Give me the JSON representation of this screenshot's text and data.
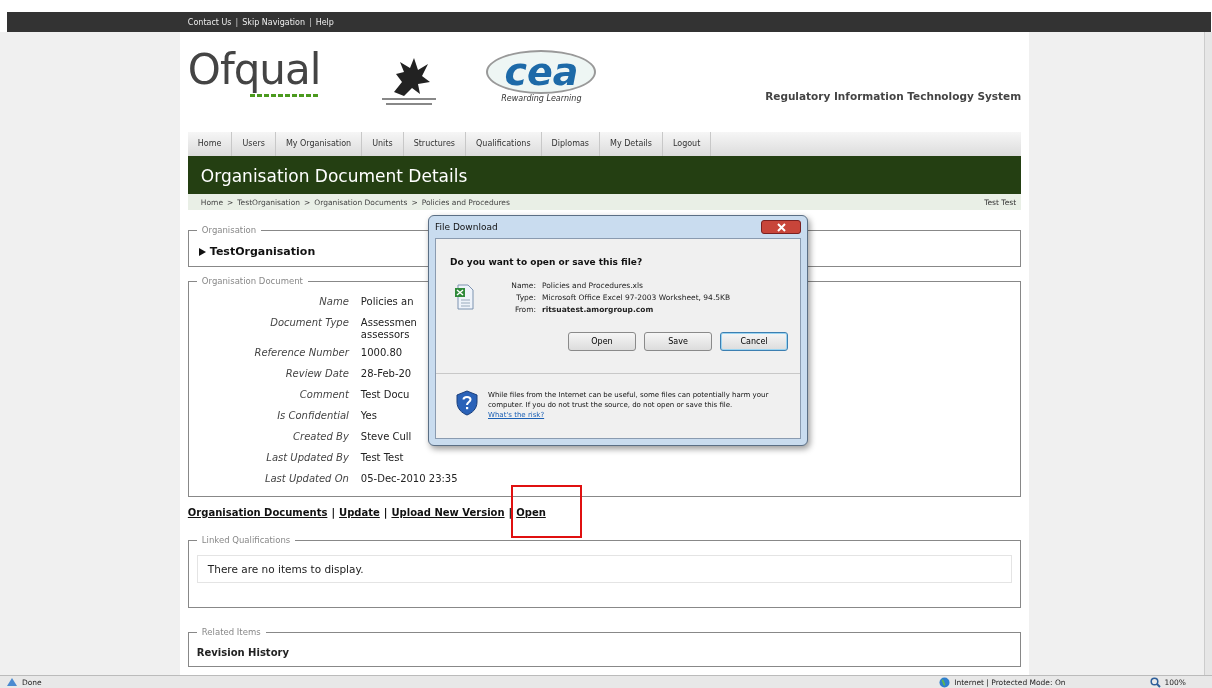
{
  "top_links": [
    "Contact Us",
    "Skip Navigation",
    "Help"
  ],
  "top_links_separator": "|",
  "header": {
    "logo": "Ofqual",
    "partner_logo": "cea",
    "partner_tagline": "Rewarding Learning",
    "system_name": "Regulatory Information Technology System"
  },
  "nav": [
    {
      "label": "Home"
    },
    {
      "label": "Users"
    },
    {
      "label": "My Organisation"
    },
    {
      "label": "Units"
    },
    {
      "label": "Structures"
    },
    {
      "label": "Qualifications"
    },
    {
      "label": "Diplomas"
    },
    {
      "label": "My Details"
    },
    {
      "label": "Logout"
    }
  ],
  "page_title": "Organisation Document Details",
  "breadcrumb": [
    "Home",
    "TestOrganisation",
    "Organisation Documents",
    "Policies and Procedures"
  ],
  "breadcrumb_separator": ">",
  "user": "Test Test",
  "organisation": {
    "legend": "Organisation",
    "name": "TestOrganisation"
  },
  "document": {
    "legend": "Organisation Document",
    "fields": [
      {
        "label": "Name",
        "value": "Policies an"
      },
      {
        "label": "Document Type",
        "value": "Assessmen\nassessors"
      },
      {
        "label": "Reference Number",
        "value": "1000.80"
      },
      {
        "label": "Review Date",
        "value": "28-Feb-20"
      },
      {
        "label": "Comment",
        "value": "Test Docu"
      },
      {
        "label": "Is Confidential",
        "value": "Yes"
      },
      {
        "label": "Created By",
        "value": "Steve Cull"
      },
      {
        "label": "Last Updated By",
        "value": "Test Test"
      },
      {
        "label": "Last Updated On",
        "value": "05-Dec-2010 23:35"
      }
    ]
  },
  "actions_separator": "|",
  "actions": [
    {
      "label": "Organisation Documents",
      "highlighted": false
    },
    {
      "label": "Update",
      "highlighted": false
    },
    {
      "label": "Upload New Version",
      "highlighted": false
    },
    {
      "label": "Open",
      "highlighted": true
    }
  ],
  "linked_qualifications": {
    "legend": "Linked Qualifications",
    "empty_text": "There are no items to display."
  },
  "related_items": {
    "legend": "Related Items",
    "heading": "Revision History"
  },
  "dialog": {
    "title": "File Download",
    "question": "Do you want to open or save this file?",
    "details": [
      {
        "label": "Name:",
        "value": "Policies and Procedures.xls",
        "bold": false
      },
      {
        "label": "Type:",
        "value": "Microsoft Office Excel 97-2003 Worksheet, 94.5KB",
        "bold": false
      },
      {
        "label": "From:",
        "value": "ritsuatest.amorgroup.com",
        "bold": true
      }
    ],
    "buttons": [
      {
        "label": "Open",
        "default": false
      },
      {
        "label": "Save",
        "default": false
      },
      {
        "label": "Cancel",
        "default": true
      }
    ],
    "warning": "While files from the Internet can be useful, some files can potentially harm your computer. If you do not trust the source, do not open or save this file.",
    "risk_link": "What's the risk?"
  },
  "status_bar": {
    "text": "Done",
    "zone": "Internet | Protected Mode: On",
    "zoom": "100%"
  }
}
